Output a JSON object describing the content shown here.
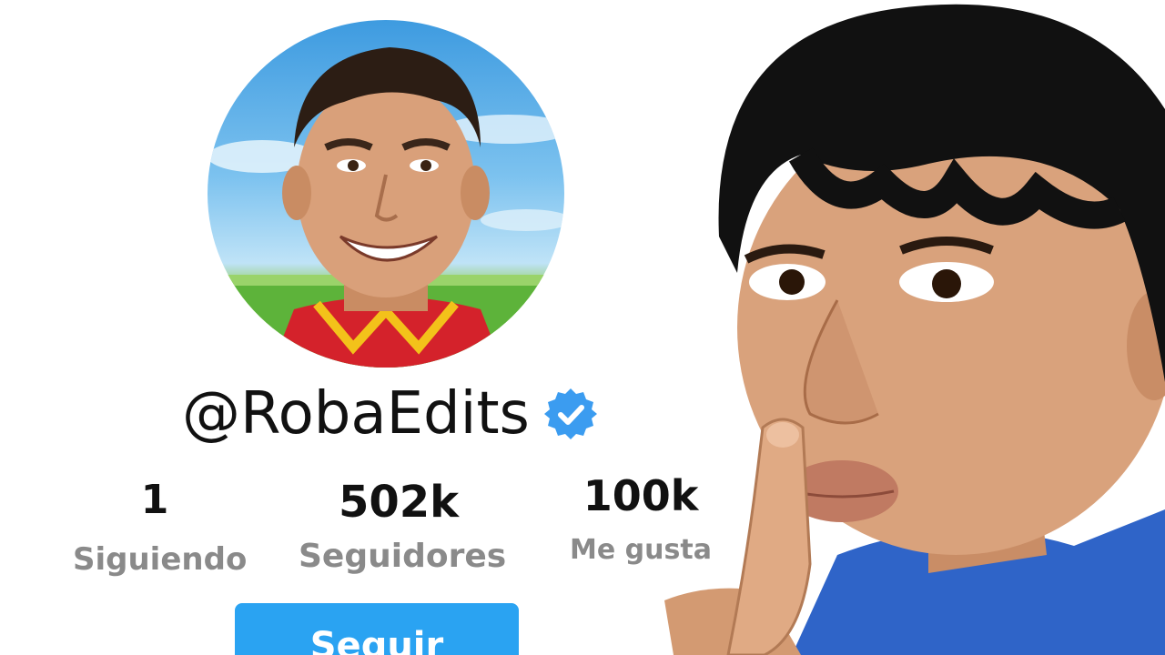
{
  "profile": {
    "username": "@RobaEdits",
    "verified": true,
    "avatar_icon": "profile-avatar-photo",
    "stats": [
      {
        "value": "1",
        "label": "Siguiendo"
      },
      {
        "value": "502k",
        "label": "Seguidores"
      },
      {
        "value": "100k",
        "label": "Me gusta"
      }
    ],
    "follow_label": "Seguir"
  },
  "colors": {
    "accent": "#2aa3f2",
    "verified": "#3b9cf0",
    "label_gray": "#8a8a8a",
    "text": "#111111"
  },
  "icons": {
    "verified": "verified-badge-icon"
  }
}
